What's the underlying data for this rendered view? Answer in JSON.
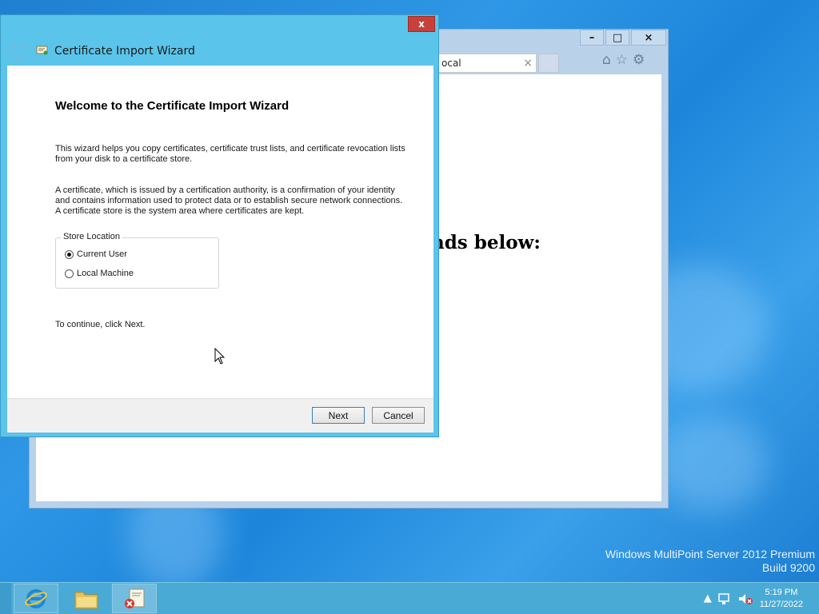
{
  "wizard": {
    "title": "Certificate Import Wizard",
    "close_label": "x",
    "heading": "Welcome to the Certificate Import Wizard",
    "intro": "This wizard helps you copy certificates, certificate trust lists, and certificate revocation lists from your disk to a certificate store.",
    "explanation": "A certificate, which is issued by a certification authority, is a confirmation of your identity and contains information used to protect data or to establish secure network connections. A certificate store is the system area where certificates are kept.",
    "store_location": {
      "legend": "Store Location",
      "options": [
        {
          "label": "Current User",
          "selected": true
        },
        {
          "label": "Local Machine",
          "selected": false
        }
      ]
    },
    "continue_text": "To continue, click Next.",
    "next_label": "Next",
    "cancel_label": "Cancel"
  },
  "browser": {
    "tab_title": "ocal",
    "tab_close": "×",
    "minimize": "–",
    "maximize": "□",
    "close": "×",
    "page_heading": "nds below:",
    "toolbar_icons": [
      "home-icon",
      "star-icon",
      "gear-icon"
    ]
  },
  "branding": {
    "edition": "Windows MultiPoint Server 2012 Premium",
    "build": "Build 9200"
  },
  "taskbar": {
    "apps": [
      "internet-explorer",
      "file-explorer",
      "certificate-manager"
    ],
    "time": "5:19 PM",
    "date": "11/27/2022"
  },
  "colors": {
    "desktop": "#2f97e6",
    "wizard_frame": "#5bc4ea",
    "taskbar": "#4aaad6",
    "close_button": "#c7403a"
  }
}
